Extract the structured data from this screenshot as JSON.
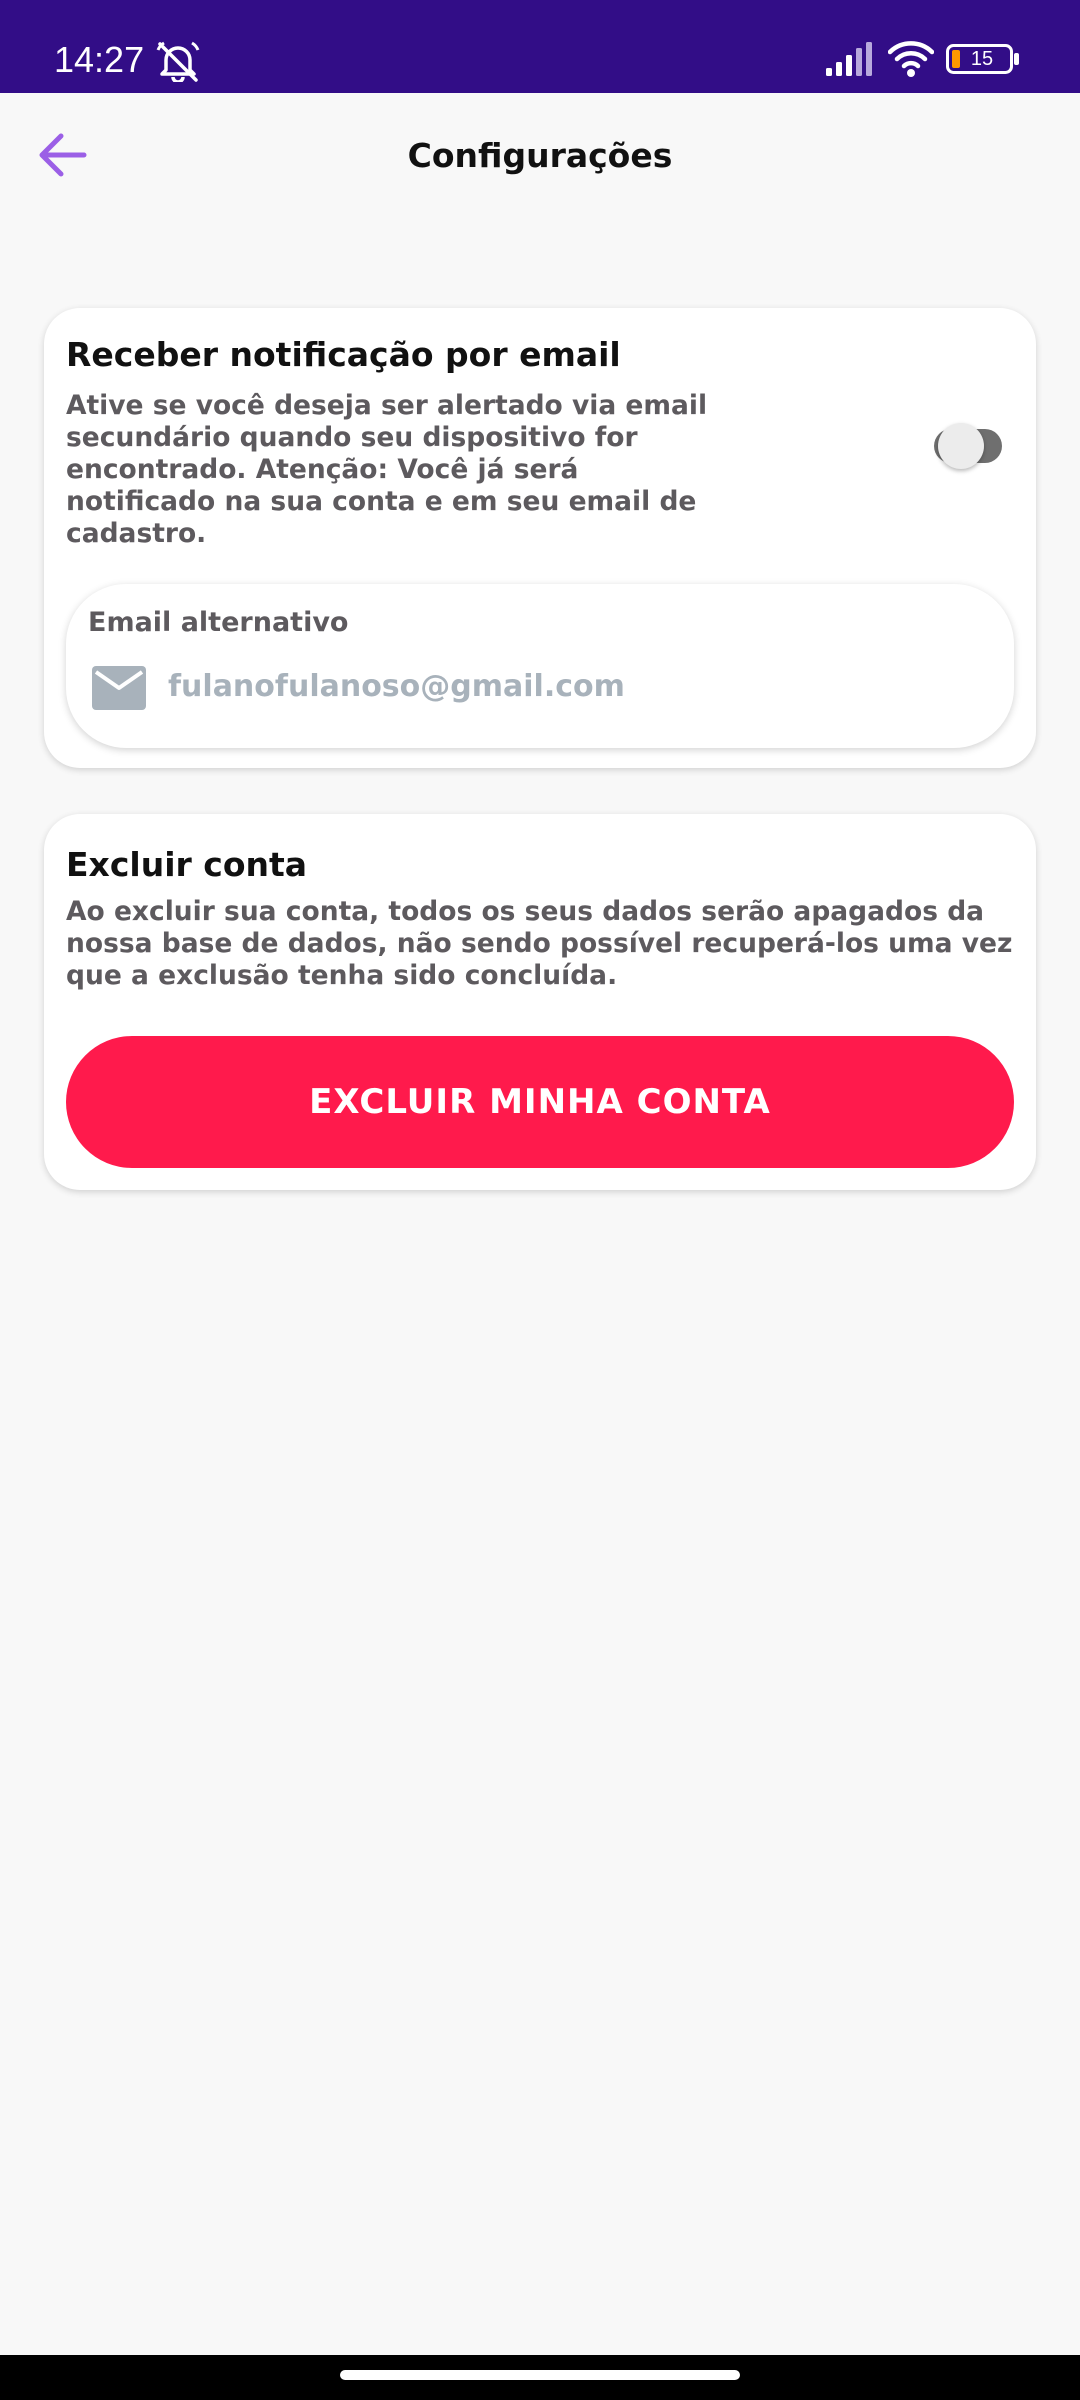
{
  "status_bar": {
    "time": "14:27",
    "battery_level": "15",
    "background_color": "#320d87",
    "icons": [
      "bell-off-icon",
      "signal-icon",
      "wifi-icon",
      "battery-icon"
    ]
  },
  "header": {
    "title": "Configurações",
    "back_icon": "arrow-left-icon",
    "accent_color": "#9b5fe6"
  },
  "notification_card": {
    "title": "Receber notificação por email",
    "description": "Ative se você deseja ser alertado via email secundário quando seu dispositivo for encontrado. Atenção: Você já será notificado na sua conta e em seu email de cadastro.",
    "toggle_on": false,
    "email_field": {
      "label": "Email alternativo",
      "placeholder": "fulanofulanoso@gmail.com",
      "value": "",
      "icon": "mail-icon"
    }
  },
  "delete_card": {
    "title": "Excluir conta",
    "description": "Ao excluir sua conta, todos os seus dados serão apagados da nossa base de dados, não sendo possível recuperá-los uma vez que a exclusão tenha sido concluída.",
    "button_label": "EXCLUIR MINHA CONTA",
    "button_color": "#ff1a4c"
  }
}
